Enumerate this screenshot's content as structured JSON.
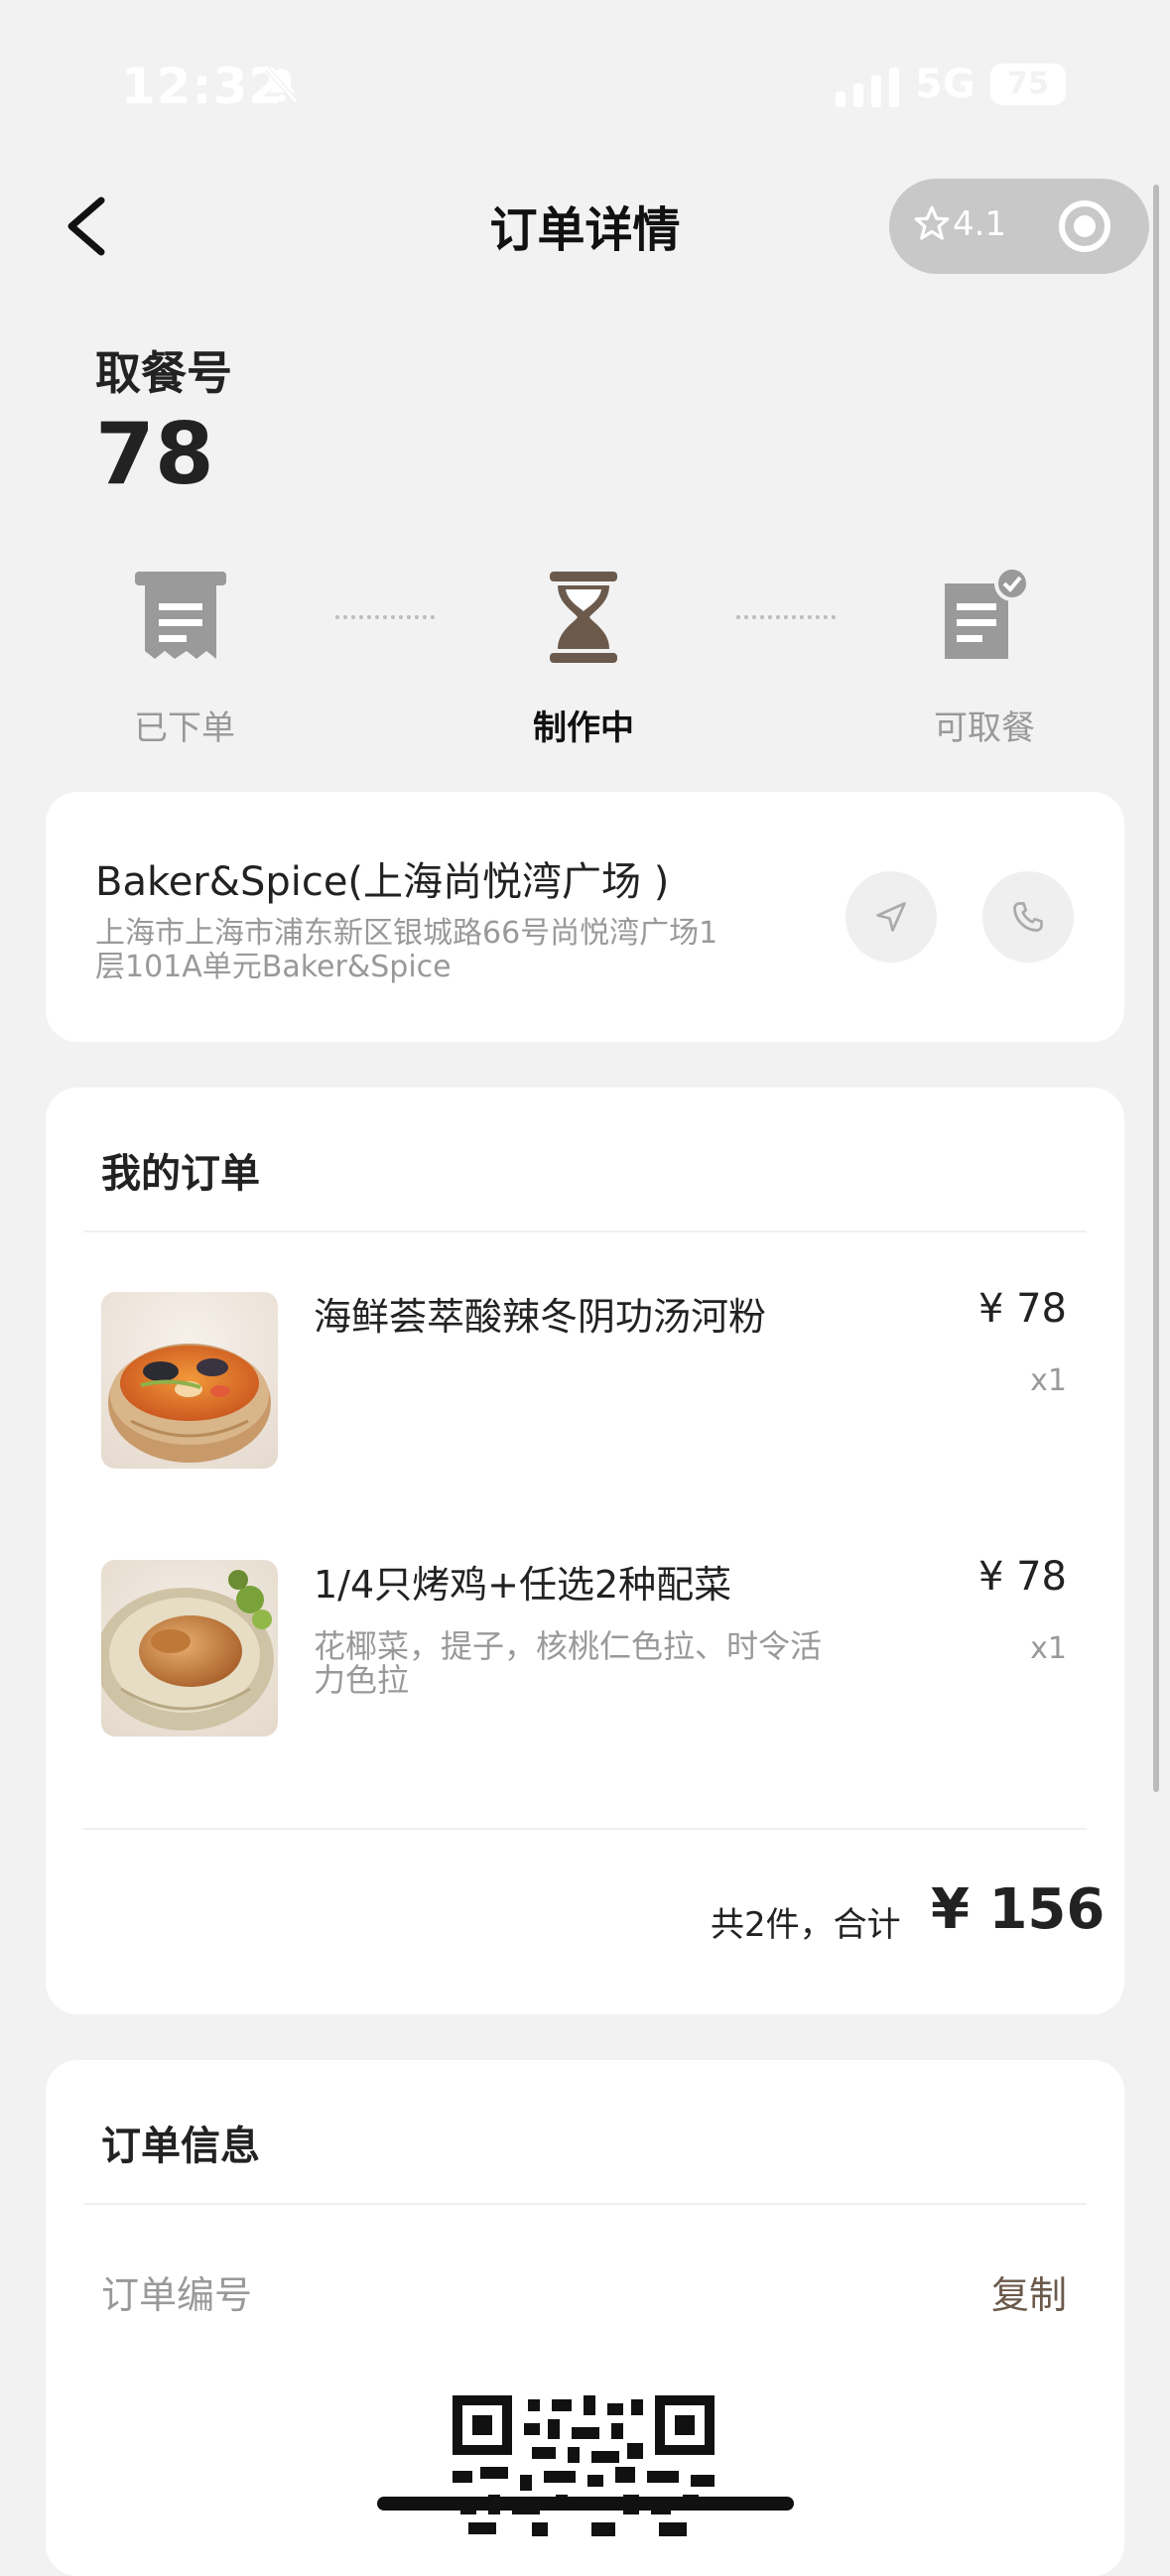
{
  "status_bar": {
    "time": "12:32",
    "network": "5G",
    "battery": "75"
  },
  "header": {
    "title": "订单详情",
    "rating": "4.1"
  },
  "pickup": {
    "label": "取餐号",
    "number": "78"
  },
  "progress": {
    "steps": [
      {
        "label": "已下单",
        "state": "done"
      },
      {
        "label": "制作中",
        "state": "active"
      },
      {
        "label": "可取餐",
        "state": "pending"
      }
    ]
  },
  "store": {
    "name": "Baker&Spice(上海尚悦湾广场 )",
    "address_line1": "上海市上海市浦东新区银城路66号尚悦湾广场1",
    "address_line2": "层101A单元Baker&Spice"
  },
  "order": {
    "title": "我的订单",
    "items": [
      {
        "name": "海鲜荟萃酸辣冬阴功汤河粉",
        "desc_line1": "",
        "desc_line2": "",
        "price": "¥ 78",
        "qty": "x1"
      },
      {
        "name": "1/4只烤鸡+任选2种配菜",
        "desc_line1": "花椰菜，提子，核桃仁色拉、时令活",
        "desc_line2": "力色拉",
        "price": "¥ 78",
        "qty": "x1"
      }
    ],
    "total_label": "共2件，合计",
    "total_value": "¥ 156"
  },
  "order_info": {
    "title": "订单信息",
    "order_number_label": "订单编号",
    "copy_label": "复制"
  },
  "colors": {
    "accent": "#6b5a4c",
    "background": "#f2f2f2",
    "card": "#ffffff"
  }
}
